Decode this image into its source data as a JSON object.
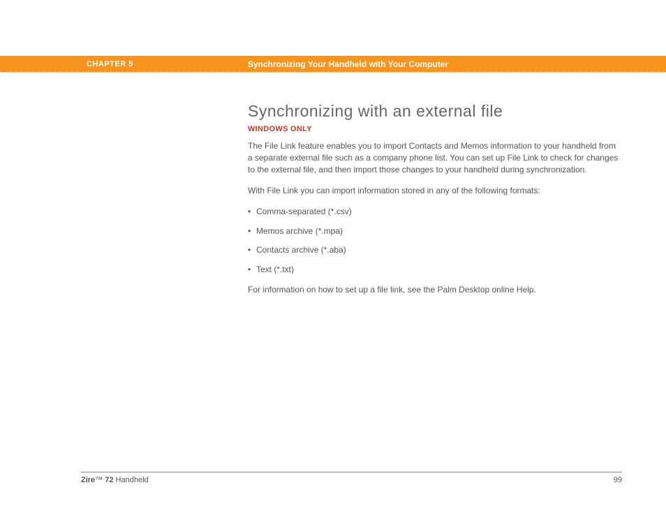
{
  "header": {
    "chapter_label": "CHAPTER 5",
    "chapter_title": "Synchronizing Your Handheld with Your Computer"
  },
  "content": {
    "heading": "Synchronizing with an external file",
    "subhead": "WINDOWS ONLY",
    "para1": "The File Link feature enables you to import Contacts and Memos information to your handheld from a separate external file such as a company phone list. You can set up File Link to check for changes to the external file, and then import those changes to your handheld during synchronization.",
    "para2": "With File Link you can import information stored in any of the following formats:",
    "bullets": [
      "Comma-separated (*.csv)",
      "Memos archive (*.mpa)",
      "Contacts archive (*.aba)",
      "Text (*.txt)"
    ],
    "para3": "For information on how to set up a file link, see the Palm Desktop online Help."
  },
  "footer": {
    "brand_bold1": "Zire",
    "brand_tm": "™",
    "brand_bold2": " 72",
    "brand_rest": " Handheld",
    "page_number": "99"
  }
}
